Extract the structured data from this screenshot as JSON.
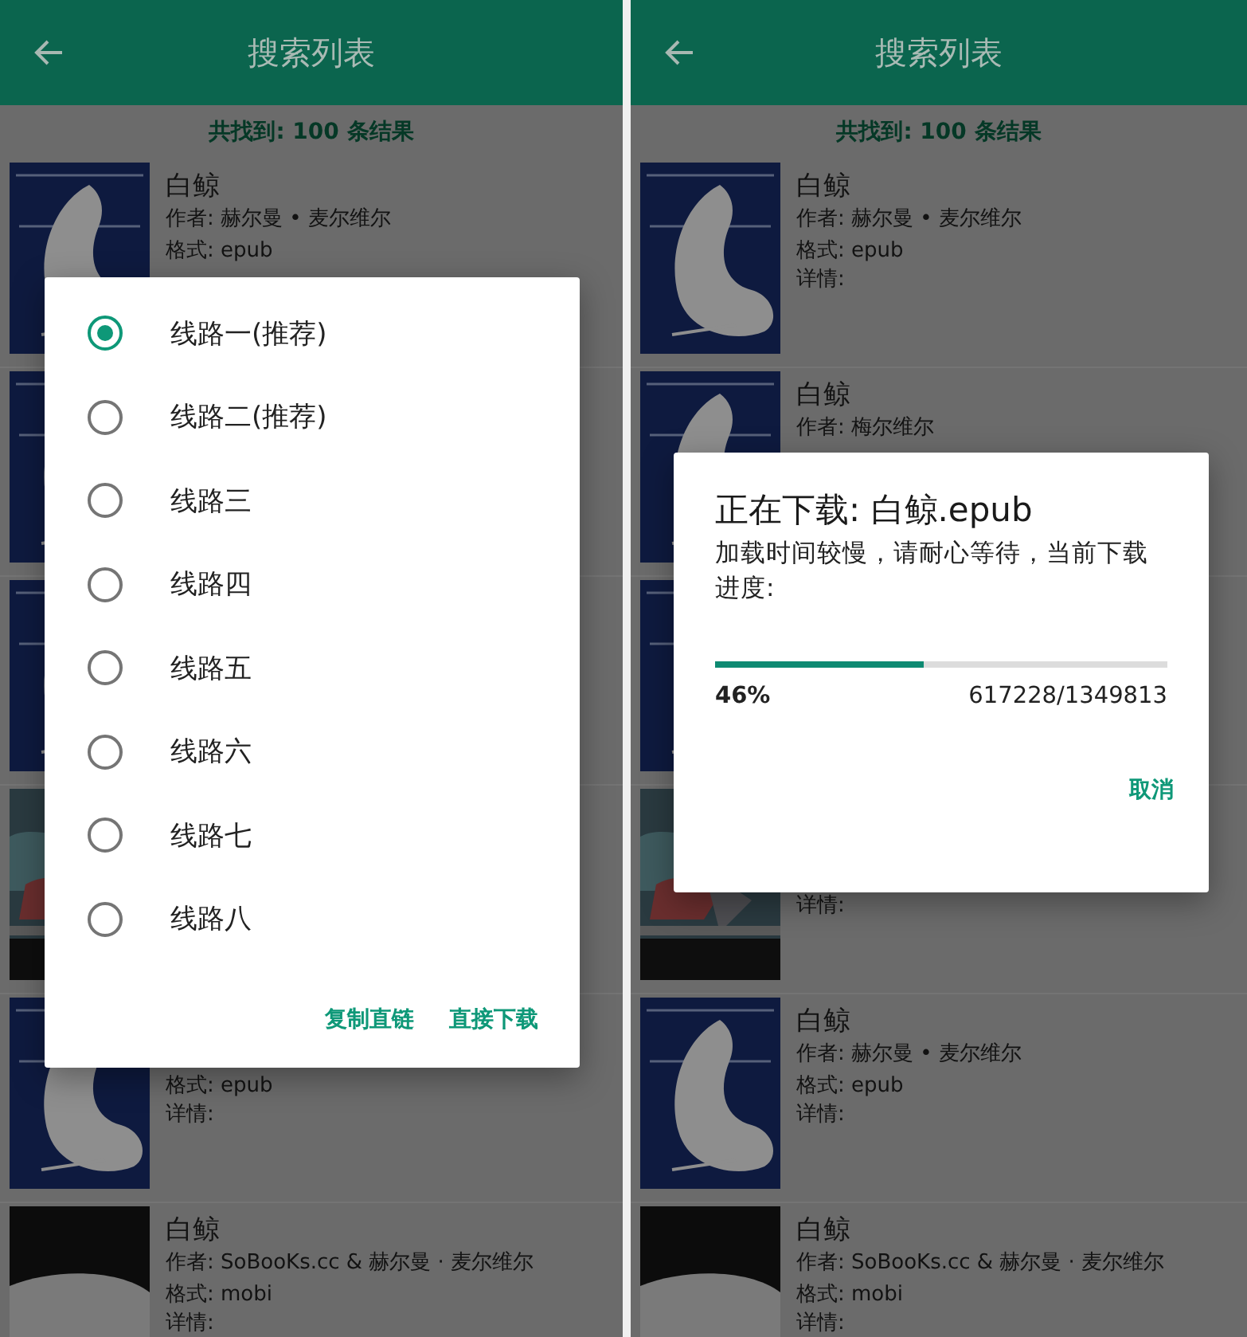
{
  "panels": [
    {
      "app_bar": {
        "title": "搜索列表"
      },
      "result_count": "共找到: 100 条结果",
      "books": [
        {
          "kind": "book",
          "title": "白鲸",
          "author": "作者: 赫尔曼 • 麦尔维尔",
          "format": "格式: epub"
        },
        {
          "kind": "book"
        },
        {
          "kind": "book"
        },
        {
          "kind": "book"
        },
        {
          "kind": "book",
          "format": "格式: epub",
          "details": "详情:"
        },
        {
          "kind": "book",
          "title": "白鲸",
          "author": "作者: SoBooKs.cc & 赫尔曼 · 麦尔维尔",
          "format": "格式: mobi",
          "details": "详情:"
        }
      ],
      "dialog": {
        "kind": "route_picker",
        "options": [
          {
            "label": "线路一(推荐)",
            "selected": true
          },
          {
            "label": "线路二(推荐)",
            "selected": false
          },
          {
            "label": "线路三",
            "selected": false
          },
          {
            "label": "线路四",
            "selected": false
          },
          {
            "label": "线路五",
            "selected": false
          },
          {
            "label": "线路六",
            "selected": false
          },
          {
            "label": "线路七",
            "selected": false
          },
          {
            "label": "线路八",
            "selected": false
          }
        ],
        "buttons": [
          "复制直链",
          "直接下载"
        ]
      }
    },
    {
      "app_bar": {
        "title": "搜索列表"
      },
      "result_count": "共找到: 100 条结果",
      "books": [
        {
          "kind": "book",
          "title": "白鲸",
          "author": "作者: 赫尔曼 • 麦尔维尔",
          "format": "格式: epub",
          "details": "详情:"
        },
        {
          "kind": "book",
          "title": "白鲸",
          "author": "作者: 梅尔维尔"
        },
        {
          "kind": "book"
        },
        {
          "kind": "book",
          "details": "详情:"
        },
        {
          "kind": "book",
          "title": "白鲸",
          "author": "作者: 赫尔曼 • 麦尔维尔",
          "format": "格式: epub",
          "details": "详情:"
        },
        {
          "kind": "book",
          "title": "白鲸",
          "author": "作者: SoBooKs.cc & 赫尔曼 · 麦尔维尔",
          "format": "格式: mobi",
          "details": "详情:"
        }
      ],
      "dialog": {
        "kind": "download_progress",
        "title": "正在下载: 白鲸.epub",
        "message": "加载时间较慢，请耐心等待，当前下载进度:",
        "level": 0.46,
        "percent": "46%",
        "bytes": "617228/1349813",
        "buttons": [
          "取消"
        ]
      }
    }
  ]
}
